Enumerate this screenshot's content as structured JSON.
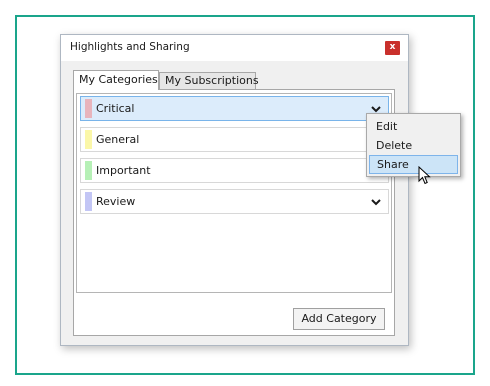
{
  "dialog": {
    "title": "Highlights and Sharing",
    "close_label": "x"
  },
  "tabs": [
    {
      "label": "My Categories",
      "active": true
    },
    {
      "label": "My Subscriptions",
      "active": false
    }
  ],
  "categories": [
    {
      "label": "Critical",
      "color": "#e8b4bc",
      "selected": true
    },
    {
      "label": "General",
      "color": "#fbf7a8",
      "selected": false
    },
    {
      "label": "Important",
      "color": "#b6f0b6",
      "selected": false
    },
    {
      "label": "Review",
      "color": "#c3c6f5",
      "selected": false
    }
  ],
  "add_button_label": "Add Category",
  "context_menu": {
    "items": [
      {
        "label": "Edit"
      },
      {
        "label": "Delete"
      },
      {
        "label": "Share",
        "hover": true
      }
    ]
  },
  "icons": {
    "close": "close-icon",
    "dropdown": "chevron-down-icon",
    "cursor": "mouse-pointer-icon"
  },
  "colors": {
    "frame_border": "#1aa58b",
    "close_button": "#c9302c",
    "selection": "#dcecfb"
  }
}
